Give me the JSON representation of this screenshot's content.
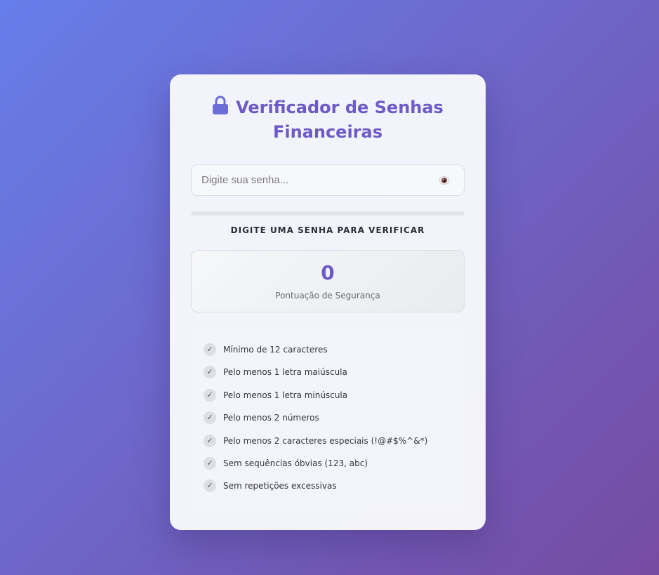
{
  "title": {
    "icon": "lock-icon",
    "line1": "Verificador de Senhas",
    "line2": "Financeiras"
  },
  "password_input": {
    "placeholder": "Digite sua senha...",
    "value": "",
    "toggle_icon": "eye-icon"
  },
  "strength": {
    "level": 0,
    "label": "Digite uma senha para verificar"
  },
  "score": {
    "value": "0",
    "caption": "Pontuação de Segurança"
  },
  "requirements": [
    {
      "icon": "check-icon",
      "text": "Mínimo de 12 caracteres",
      "met": false
    },
    {
      "icon": "check-icon",
      "text": "Pelo menos 1 letra maiúscula",
      "met": false
    },
    {
      "icon": "check-icon",
      "text": "Pelo menos 1 letra minúscula",
      "met": false
    },
    {
      "icon": "check-icon",
      "text": "Pelo menos 2 números",
      "met": false
    },
    {
      "icon": "check-icon",
      "text": "Pelo menos 2 caracteres especiais (!@#$%^&*)",
      "met": false
    },
    {
      "icon": "check-icon",
      "text": "Sem sequências óbvias (123, abc)",
      "met": false
    },
    {
      "icon": "check-icon",
      "text": "Sem repetições excessivas",
      "met": false
    }
  ],
  "colors": {
    "accent": "#6c5bc7",
    "gradient_start": "#667eea",
    "gradient_end": "#764ba2"
  }
}
